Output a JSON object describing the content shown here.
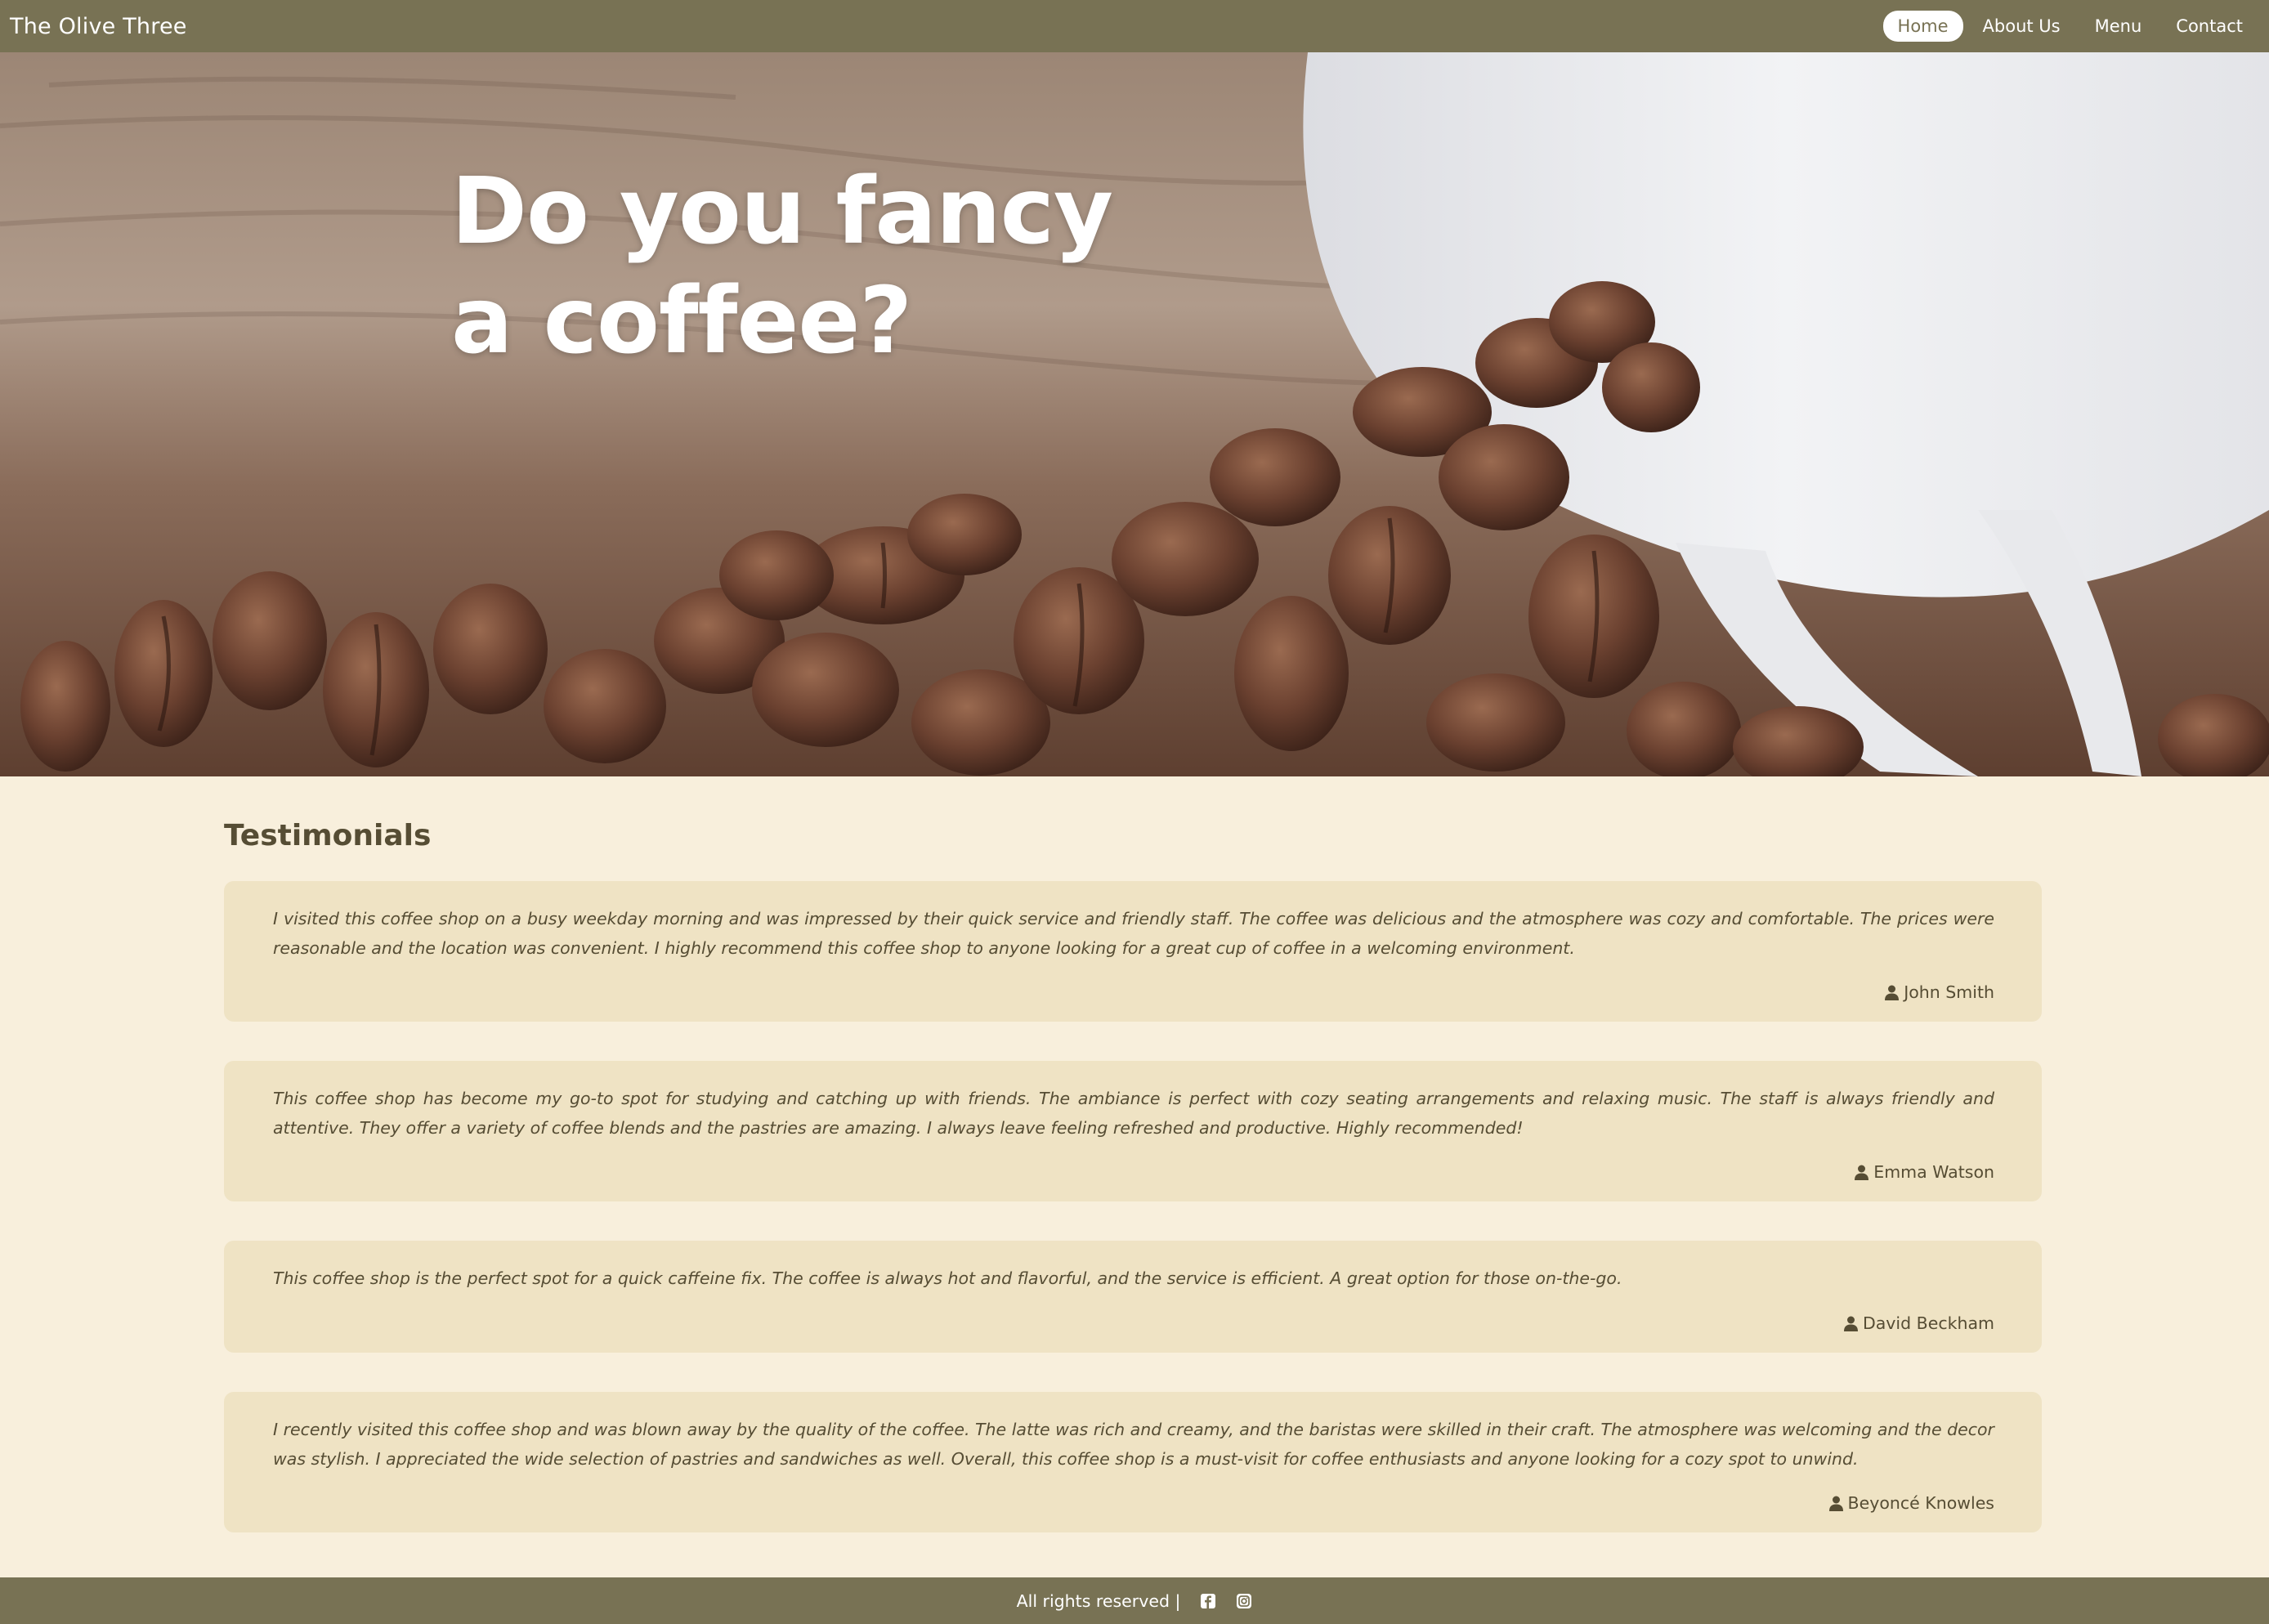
{
  "navbar": {
    "brand": "The Olive Three",
    "links": [
      {
        "label": "Home",
        "active": true
      },
      {
        "label": "About Us",
        "active": false
      },
      {
        "label": "Menu",
        "active": false
      },
      {
        "label": "Contact",
        "active": false
      }
    ]
  },
  "hero": {
    "title": "Do you fancy a coffee?",
    "background_image": "coffee-beans-and-white-cup"
  },
  "testimonials": {
    "title": "Testimonials",
    "items": [
      {
        "quote": "I visited this coffee shop on a busy weekday morning and was impressed by their quick service and friendly staff. The coffee was delicious and the atmosphere was cozy and comfortable. The prices were reasonable and the location was convenient. I highly recommend this coffee shop to anyone looking for a great cup of coffee in a welcoming environment.",
        "author": "John Smith"
      },
      {
        "quote": "This coffee shop has become my go-to spot for studying and catching up with friends. The ambiance is perfect with cozy seating arrangements and relaxing music. The staff is always friendly and attentive. They offer a variety of coffee blends and the pastries are amazing. I always leave feeling refreshed and productive. Highly recommended!",
        "author": "Emma Watson"
      },
      {
        "quote": "This coffee shop is the perfect spot for a quick caffeine fix. The coffee is always hot and flavorful, and the service is efficient. A great option for those on-the-go.",
        "author": "David Beckham"
      },
      {
        "quote": "I recently visited this coffee shop and was blown away by the quality of the coffee. The latte was rich and creamy, and the baristas were skilled in their craft. The atmosphere was welcoming and the decor was stylish. I appreciated the wide selection of pastries and sandwiches as well. Overall, this coffee shop is a must-visit for coffee enthusiasts and anyone looking for a cozy spot to unwind.",
        "author": "Beyoncé Knowles"
      }
    ]
  },
  "footer": {
    "text": "All rights reserved |",
    "social_icons": [
      "facebook-icon",
      "instagram-icon"
    ]
  },
  "colors": {
    "navbar_bg": "#787254",
    "page_bg": "#f8efdc",
    "card_bg": "#efe3c4",
    "text": "#564d34",
    "hero_title": "#ffffff"
  }
}
